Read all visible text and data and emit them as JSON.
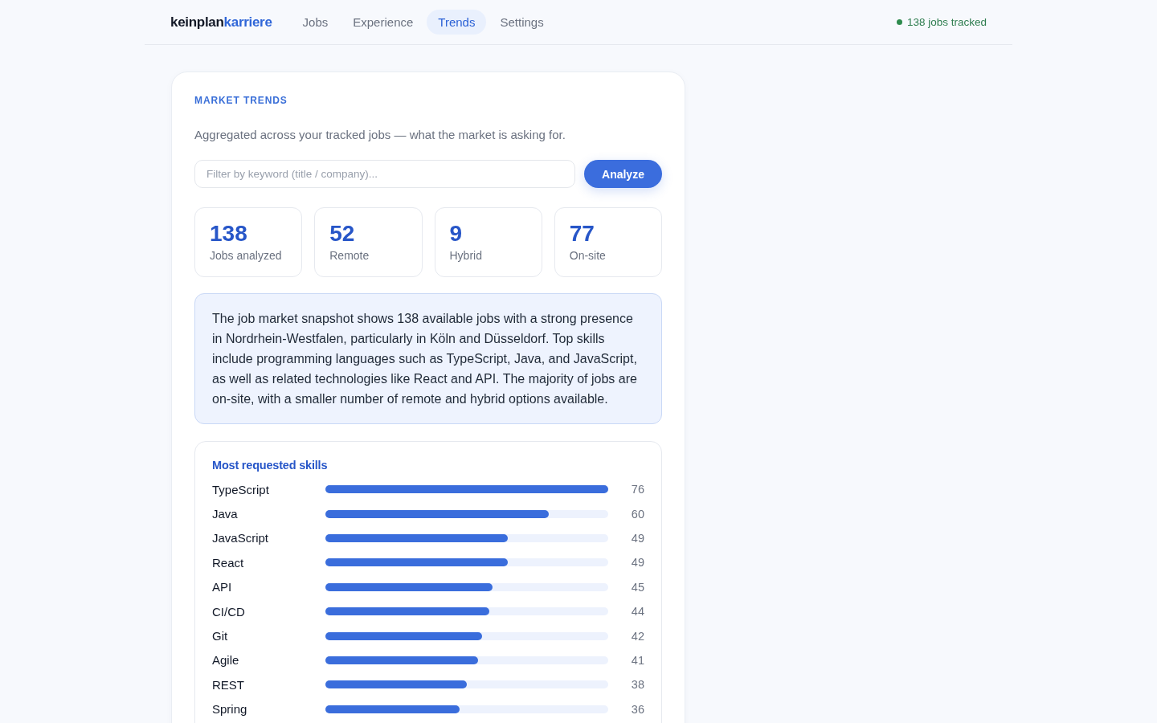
{
  "header": {
    "logo": [
      {
        "text": "keinplan",
        "kind": "plain"
      },
      {
        "text": "karriere",
        "kind": "accent"
      }
    ],
    "nav": [
      {
        "label": "Jobs",
        "selected": false
      },
      {
        "label": "Experience",
        "selected": false
      },
      {
        "label": "Trends",
        "selected": true
      },
      {
        "label": "Settings",
        "selected": false
      }
    ],
    "status": {
      "label": "138 jobs tracked"
    }
  },
  "trends": {
    "eyebrow": "MARKET TRENDS",
    "subtitle": "Aggregated across your tracked jobs — what the market is asking for.",
    "filter": {
      "placeholder": "Filter by keyword (title / company)..."
    },
    "analyze_button": "Analyze",
    "stats": [
      {
        "value": "138",
        "label": "Jobs analyzed"
      },
      {
        "value": "52",
        "label": "Remote"
      },
      {
        "value": "9",
        "label": "Hybrid"
      },
      {
        "value": "77",
        "label": "On-site"
      }
    ],
    "summary": "The job market snapshot shows 138 available jobs with a strong presence in Nordrhein-Westfalen, particularly in Köln and Düsseldorf. Top skills include programming languages such as TypeScript, Java, and JavaScript, as well as related technologies like React and API. The majority of jobs are on-site, with a smaller number of remote and hybrid options available.",
    "skills": {
      "title": "Most requested skills",
      "items": [
        {
          "name": "TypeScript",
          "level": 1.0,
          "count": "76"
        },
        {
          "name": "Java",
          "level": 0.789,
          "count": "60"
        },
        {
          "name": "JavaScript",
          "level": 0.645,
          "count": "49"
        },
        {
          "name": "React",
          "level": 0.645,
          "count": "49"
        },
        {
          "name": "API",
          "level": 0.592,
          "count": "45"
        },
        {
          "name": "CI/CD",
          "level": 0.579,
          "count": "44"
        },
        {
          "name": "Git",
          "level": 0.553,
          "count": "42"
        },
        {
          "name": "Agile",
          "level": 0.539,
          "count": "41"
        },
        {
          "name": "REST",
          "level": 0.5,
          "count": "38"
        },
        {
          "name": "Spring",
          "level": 0.474,
          "count": "36"
        }
      ]
    }
  }
}
